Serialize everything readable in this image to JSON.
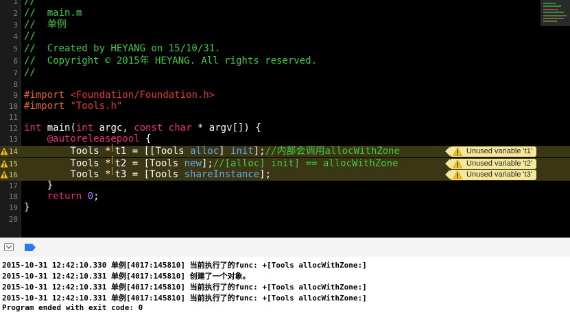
{
  "editor": {
    "lines": [
      {
        "num": "1",
        "text": "//"
      },
      {
        "num": "2",
        "text": "//  main.m"
      },
      {
        "num": "3",
        "text": "//  单例"
      },
      {
        "num": "4",
        "text": "//"
      },
      {
        "num": "5",
        "text": "//  Created by HEYANG on 15/10/31."
      },
      {
        "num": "6",
        "text": "//  Copyright © 2015年 HEYANG. All rights reserved."
      },
      {
        "num": "7",
        "text": "//"
      },
      {
        "num": "8",
        "text": ""
      },
      {
        "num": "9",
        "text": "#import <Foundation/Foundation.h>"
      },
      {
        "num": "10",
        "text": "#import \"Tools.h\""
      },
      {
        "num": "11",
        "text": ""
      },
      {
        "num": "12",
        "text": "int main(int argc, const char * argv[]) {"
      },
      {
        "num": "13",
        "text": "    @autoreleasepool {"
      },
      {
        "num": "14",
        "text": "        Tools *t1 = [[Tools alloc] init];//内部会调用allocWithZone"
      },
      {
        "num": "15",
        "text": "        Tools *t2 = [Tools new];//[alloc] init] == allocWithZone"
      },
      {
        "num": "16",
        "text": "        Tools *t3 = [Tools shareInstance];"
      },
      {
        "num": "17",
        "text": "    }"
      },
      {
        "num": "18",
        "text": "    return 0;"
      },
      {
        "num": "19",
        "text": "}"
      },
      {
        "num": "20",
        "text": ""
      }
    ],
    "tokens": {
      "l1": "//",
      "l2": "//  main.m",
      "l3": "//  单例",
      "l4": "//",
      "l5": "//  Created by HEYANG on 15/10/31.",
      "l6": "//  Copyright © 2015年 HEYANG. All rights reserved.",
      "l7": "//",
      "l9_kw": "#import",
      "l9_str": "<Foundation/Foundation.h>",
      "l10_kw": "#import",
      "l10_str": "\"Tools.h\"",
      "l12_int": "int",
      "l12_a": " main(",
      "l12_int2": "int",
      "l12_b": " argc, ",
      "l12_const": "const",
      "l12_c": " ",
      "l12_char": "char",
      "l12_d": " * argv[]) {",
      "l13_indent": "    ",
      "l13_kw": "@autoreleasepool",
      "l13_rest": " {",
      "l14_a": "        Tools *",
      "l14_b": "t1 = [[Tools ",
      "l14_alloc": "alloc",
      "l14_c": "] ",
      "l14_init": "init",
      "l14_d": "];",
      "l14_comment": "//内部会调用allocWithZone",
      "l15_a": "        Tools *",
      "l15_b": "t2 = [Tools ",
      "l15_new": "new",
      "l15_c": "];",
      "l15_comment": "//[alloc] init] == allocWithZone",
      "l16_a": "        Tools *",
      "l16_b": "t3 = [Tools ",
      "l16_share": "shareInstance",
      "l16_c": "];",
      "l17": "    }",
      "l18_indent": "    ",
      "l18_kw": "return",
      "l18_sp": " ",
      "l18_num": "0",
      "l18_end": ";",
      "l19": "}"
    },
    "warnings": [
      {
        "line": "14",
        "message": "Unused variable 't1'"
      },
      {
        "line": "15",
        "message": "Unused variable 't2'"
      },
      {
        "line": "16",
        "message": "Unused variable 't3'"
      }
    ]
  },
  "console": {
    "lines": [
      "2015-10-31 12:42:10.330 单例[4017:145810] 当前执行了的func: +[Tools allocWithZone:]",
      "2015-10-31 12:42:10.331 单例[4017:145810] 创建了一个对象。",
      "2015-10-31 12:42:10.331 单例[4017:145810] 当前执行了的func: +[Tools allocWithZone:]",
      "2015-10-31 12:42:10.331 单例[4017:145810] 当前执行了的func: +[Tools allocWithZone:]",
      "Program ended with exit code: 0"
    ]
  },
  "colors": {
    "comment": "#41cc45",
    "keyword": "#e82f79",
    "directive": "#e0662e",
    "string": "#e03a3a",
    "method": "#61aef2",
    "number": "#a68bff",
    "warning_line_bg": "#3b3614",
    "warning_badge_bg": "#f5e89d",
    "breakpoint_blue": "#2b7be8"
  },
  "icons": {
    "debug_toggle": "hide-debug-area-icon",
    "breakpoints": "breakpoints-toggle-icon",
    "warning": "warning-triangle-icon"
  }
}
